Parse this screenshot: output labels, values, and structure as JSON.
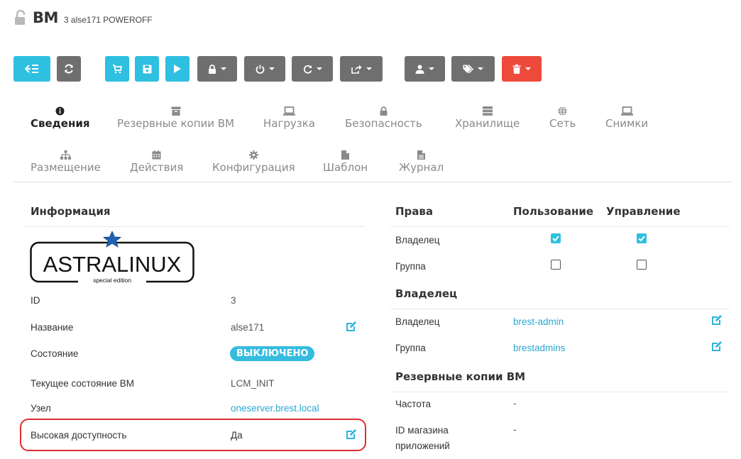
{
  "header": {
    "title": "ВМ",
    "subtitle": "3 alse171 POWEROFF"
  },
  "toolbar": {
    "buttons": [
      {
        "name": "back",
        "icon": "back-list-icon",
        "color": "#2fbfe0"
      },
      {
        "name": "refresh",
        "icon": "refresh-icon",
        "color": "#6f6f6f"
      },
      {
        "name": "cart",
        "icon": "cart-icon",
        "color": "#2fbfe0"
      },
      {
        "name": "save",
        "icon": "save-icon",
        "color": "#2fbfe0"
      },
      {
        "name": "play",
        "icon": "play-icon",
        "color": "#2fbfe0"
      },
      {
        "name": "lock",
        "icon": "lock-icon",
        "color": "#6f6f6f"
      },
      {
        "name": "power",
        "icon": "power-icon",
        "color": "#6f6f6f"
      },
      {
        "name": "reboot",
        "icon": "reboot-icon",
        "color": "#6f6f6f"
      },
      {
        "name": "share",
        "icon": "share-icon",
        "color": "#6f6f6f"
      },
      {
        "name": "user",
        "icon": "user-icon",
        "color": "#6f6f6f"
      },
      {
        "name": "tags",
        "icon": "tags-icon",
        "color": "#6f6f6f"
      },
      {
        "name": "delete",
        "icon": "trash-icon",
        "color": "#ee4a3c"
      }
    ]
  },
  "tabs": {
    "info": "Сведения",
    "backups": "Резервные копии ВМ",
    "load": "Нагрузка",
    "security": "Безопасность",
    "storage": "Хранилище",
    "network": "Сеть",
    "snapshots": "Снимки",
    "placement": "Размещение",
    "actions": "Действия",
    "config": "Конфигурация",
    "template": "Шаблон",
    "log": "Журнал"
  },
  "info": {
    "title": "Информация",
    "logo_text": "ASTRALINUX",
    "logo_sub": "special edition",
    "rows": {
      "id_label": "ID",
      "id_value": "3",
      "name_label": "Название",
      "name_value": "alse171",
      "state_label": "Состояние",
      "state_value": "ВЫКЛЮЧЕНО",
      "lcm_label": "Текущее состояние ВМ",
      "lcm_value": "LCM_INIT",
      "host_label": "Узел",
      "host_value": "oneserver.brest.local",
      "ha_label": "Высокая доступность",
      "ha_value": "Да"
    }
  },
  "permissions": {
    "title": "Права",
    "col_use": "Пользование",
    "col_manage": "Управление",
    "owner_label": "Владелец",
    "group_label": "Группа",
    "owner_use": true,
    "owner_manage": true,
    "group_use": false,
    "group_manage": false
  },
  "ownership": {
    "title": "Владелец",
    "owner_label": "Владелец",
    "owner_value": "brest-admin",
    "group_label": "Группа",
    "group_value": "brestadmins"
  },
  "backups": {
    "title": "Резервные копии ВМ",
    "freq_label": "Частота",
    "freq_value": "-",
    "store_label_1": "ID магазина",
    "store_label_2": "приложений",
    "store_value": "-"
  },
  "colors": {
    "accent": "#2fbfe0",
    "danger": "#ee4a3c",
    "highlight": "#e12d2d"
  }
}
